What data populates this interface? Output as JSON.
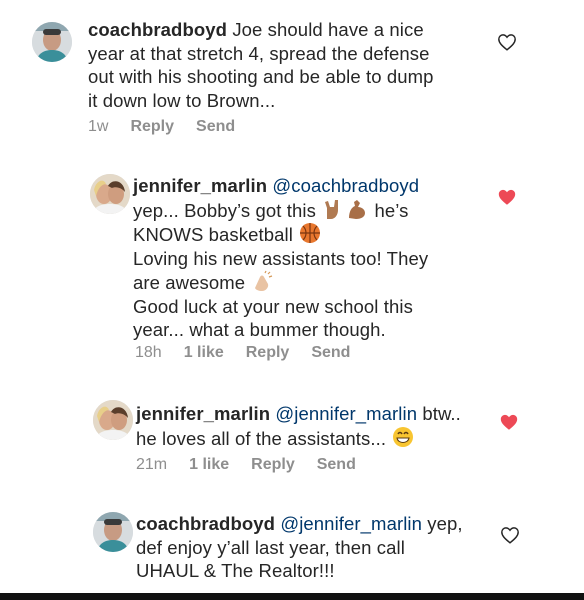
{
  "comments": [
    {
      "username": "coachbradboyd",
      "lines": [
        "Joe should have a nice",
        "year at that stretch 4, spread the defense",
        "out with his shooting and be able to dump",
        "it down low to Brown..."
      ],
      "time": "1w",
      "reply_label": "Reply",
      "send_label": "Send",
      "liked": false
    },
    {
      "username": "jennifer_marlin",
      "mention": "@coachbradboyd",
      "line1": "yep... Bobby’s got this",
      "line1_end": "he’s",
      "line2": "KNOWS basketball",
      "line3": "Loving his new assistants too! They",
      "line4": "are awesome",
      "line5": "Good luck at your new school this",
      "line6": "year... what a bummer though.",
      "time": "18h",
      "likes": "1 like",
      "reply_label": "Reply",
      "send_label": "Send",
      "liked": true
    },
    {
      "username": "jennifer_marlin",
      "mention": "@jennifer_marlin",
      "line1_end": "btw..",
      "line2": "he loves all of the assistants...",
      "time": "21m",
      "likes": "1 like",
      "reply_label": "Reply",
      "send_label": "Send",
      "liked": true
    },
    {
      "username": "coachbradboyd",
      "mention": "@jennifer_marlin",
      "line1_end": "yep,",
      "line2": "def enjoy y’all last year, then call",
      "line3": "UHAUL & The Realtor!!!",
      "liked": false
    }
  ],
  "icons": {
    "heart_outline": "heart-outline-icon",
    "heart_filled": "heart-filled-icon",
    "heart_color": "#ed4956"
  },
  "colors": {
    "mention": "#00376b",
    "meta": "#8e8e8e",
    "text": "#262626"
  }
}
